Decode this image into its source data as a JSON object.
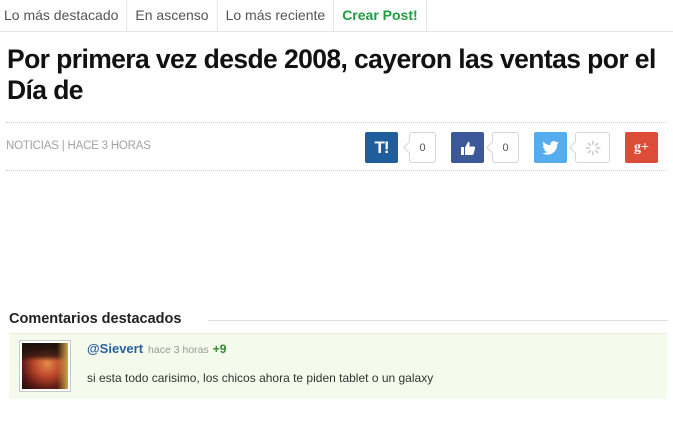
{
  "nav": {
    "tabs": [
      {
        "label": "Lo más destacado"
      },
      {
        "label": "En ascenso"
      },
      {
        "label": "Lo más reciente"
      },
      {
        "label": "Crear Post!"
      }
    ]
  },
  "article": {
    "title": "Por primera vez desde 2008, cayeron las ventas por el Día de",
    "meta": "NOTICIAS | HACE 3 HORAS"
  },
  "share": {
    "taringa": {
      "icon": "taringa-t-icon",
      "label": "T!",
      "count": "0",
      "color": "#1f5d9c"
    },
    "like": {
      "icon": "thumbs-up-icon",
      "count": "0",
      "color": "#3b5998"
    },
    "twitter": {
      "icon": "twitter-bird-icon",
      "color": "#55acee"
    },
    "loading": {
      "icon": "loading-spinner-icon"
    },
    "googleplus": {
      "icon": "google-plus-icon",
      "label": "g+",
      "color": "#dd4b39"
    }
  },
  "comments": {
    "section_title": "Comentarios destacados",
    "items": [
      {
        "user": "@Sievert",
        "time": "hace 3 horas",
        "score": "+9",
        "text": "si esta todo carisimo, los chicos ahora te piden tablet o un galaxy"
      }
    ]
  }
}
